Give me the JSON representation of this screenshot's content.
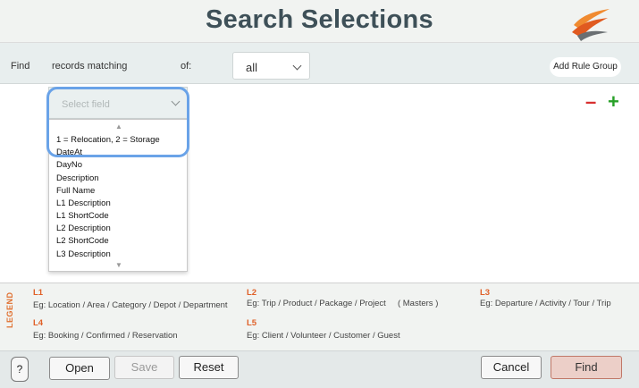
{
  "header": {
    "title": "Search Selections"
  },
  "find_bar": {
    "find_label": "Find",
    "records_label": "records matching",
    "of_label": "of:",
    "match_value": "all",
    "add_rule_group": "Add Rule Group"
  },
  "rule": {
    "field_placeholder": "Select field",
    "options": [
      "1 = Relocation, 2 = Storage",
      "DateAt",
      "DayNo",
      "Description",
      "Full Name",
      "L1 Description",
      "L1 ShortCode",
      "L2 Description",
      "L2 ShortCode",
      "L3 Description"
    ],
    "remove_symbol": "–",
    "add_symbol": "+"
  },
  "legend": {
    "tag": "LEGEND",
    "levels": [
      {
        "label": "L1",
        "desc": "Eg: Location / Area / Category / Depot / Department"
      },
      {
        "label": "L2",
        "desc": "Eg: Trip / Product / Package / Project     ( Masters )"
      },
      {
        "label": "L3",
        "desc": "Eg: Departure / Activity / Tour / Trip"
      },
      {
        "label": "L4",
        "desc": "Eg: Booking / Confirmed / Reservation"
      },
      {
        "label": "L5",
        "desc": "Eg: Client / Volunteer / Customer / Guest"
      }
    ]
  },
  "footer": {
    "help": "?",
    "open": "Open",
    "save": "Save",
    "reset": "Reset",
    "cancel": "Cancel",
    "find": "Find"
  },
  "colors": {
    "title": "#3e5058",
    "accent_orange": "#e06028",
    "focus_ring": "#6aa3e8",
    "remove": "#d83030",
    "add": "#28a028",
    "find_button": "#eccfc8"
  }
}
